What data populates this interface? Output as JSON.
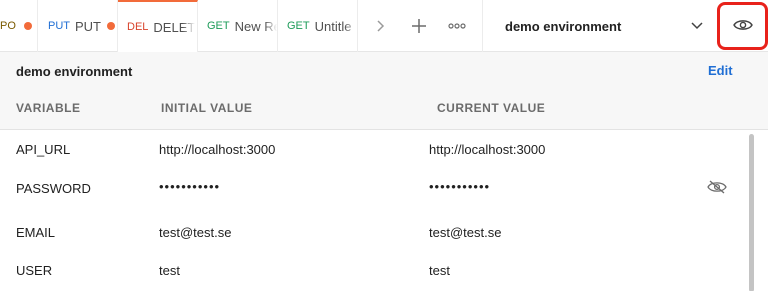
{
  "tabs": [
    {
      "method": "PO",
      "method_color": "#a06a00",
      "name": "",
      "unsaved": true
    },
    {
      "method": "PUT",
      "method_color": "#1f6ed4",
      "name": "PUT",
      "unsaved": true
    },
    {
      "method": "DEL",
      "method_color": "#d8432b",
      "name": "DELETE",
      "unsaved": false,
      "active": true
    },
    {
      "method": "GET",
      "method_color": "#1e9c5a",
      "name": "New Re",
      "unsaved": false
    },
    {
      "method": "GET",
      "method_color": "#1e9c5a",
      "name": "Untitle",
      "unsaved": false
    }
  ],
  "toolbar": {
    "more_tabs_icon": "chevron-right-icon",
    "new_tab_icon": "plus-icon",
    "options_icon": "ellipsis-icon"
  },
  "environment": {
    "selected": "demo environment",
    "quick_look_icon": "eye-icon"
  },
  "panel": {
    "title": "demo environment",
    "edit_label": "Edit",
    "headers": {
      "variable": "VARIABLE",
      "initial": "INITIAL VALUE",
      "current": "CURRENT VALUE"
    },
    "rows": [
      {
        "variable": "API_URL",
        "initial": "http://localhost:3000",
        "current": "http://localhost:3000"
      },
      {
        "variable": "PASSWORD",
        "initial": "•••••••••••",
        "current": "•••••••••••",
        "secret": true
      },
      {
        "variable": "EMAIL",
        "initial": "test@test.se",
        "current": "test@test.se"
      },
      {
        "variable": "USER",
        "initial": "test",
        "current": "test"
      }
    ]
  }
}
